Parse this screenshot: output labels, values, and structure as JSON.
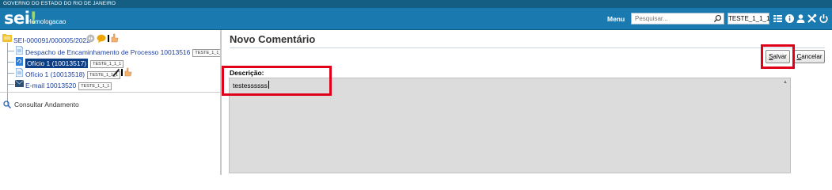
{
  "gov_bar": {
    "text": "GOVERNO DO ESTADO DO RIO DE JANEIRO"
  },
  "header": {
    "logo_text": "sei",
    "logo_excl": "!",
    "environment": "Homologacao",
    "menu_label": "Menu",
    "search_placeholder": "Pesquisar...",
    "user_unit": "TESTE_1_1_1",
    "icons": [
      "search-icon",
      "list-icon",
      "info-icon",
      "user-icon",
      "tools-icon",
      "power-icon"
    ]
  },
  "tree": {
    "process": {
      "label": "SEI-000091/000005/2022"
    },
    "items": [
      {
        "label": "Despacho de Encaminhamento de Processo 10013516",
        "tag": "TESTE_1_1_1"
      },
      {
        "label": "Ofício 1 (10013517)",
        "tag": "TESTE_1_1_1",
        "selected": true
      },
      {
        "label": "Ofício 1 (10013518)",
        "tag": "TESTE_1_1_1"
      },
      {
        "label": "E-mail 10013520",
        "tag": "TESTE_1_1_1"
      }
    ],
    "consult_label": "Consultar Andamento"
  },
  "form": {
    "title": "Novo Comentário",
    "save_label_hotkey": "S",
    "save_label_rest": "alvar",
    "cancel_label_hotkey": "C",
    "cancel_label_rest": "ancelar",
    "description_label": "Descrição:",
    "description_value": "testessssss"
  },
  "colors": {
    "header": "#1a7ab0",
    "gov_bar": "#155e83",
    "highlight": "#e0001a",
    "selected_bg": "#0c3e86",
    "textarea_bg": "#dcdcdc"
  }
}
